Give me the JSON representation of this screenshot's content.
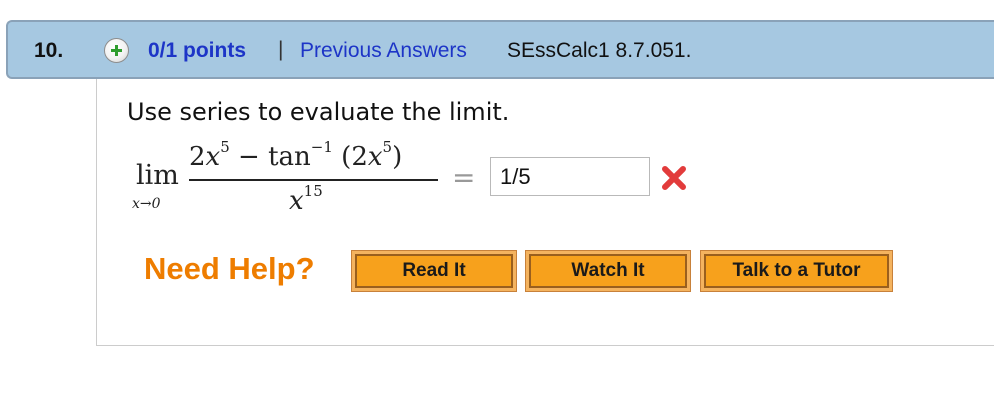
{
  "question": {
    "number": "10.",
    "points": "0/1 points",
    "separator": "|",
    "previous_answers": "Previous Answers",
    "source": "SEssCalc1 8.7.051."
  },
  "content": {
    "prompt": "Use series to evaluate the limit.",
    "math": {
      "lim": "lim",
      "lim_sub": "x→0",
      "numerator_coef": "2",
      "numerator_var": "x",
      "numerator_exp": "5",
      "minus": " − tan",
      "tan_exp": "−1",
      "paren_open": " (2",
      "paren_var": "x",
      "paren_exp": "5",
      "paren_close": ")",
      "denominator_var": "x",
      "denominator_exp": "15",
      "equals": "="
    },
    "answer_value": "1/5",
    "answer_status_icon": "x-icon"
  },
  "help": {
    "label": "Need Help?",
    "buttons": [
      "Read It",
      "Watch It",
      "Talk to a Tutor"
    ]
  },
  "colors": {
    "header_bg": "#a6c8e1",
    "link": "#1d35c7",
    "need_help": "#ee7d00",
    "button": "#f7a11c",
    "wrong_mark": "#e23b3b"
  }
}
